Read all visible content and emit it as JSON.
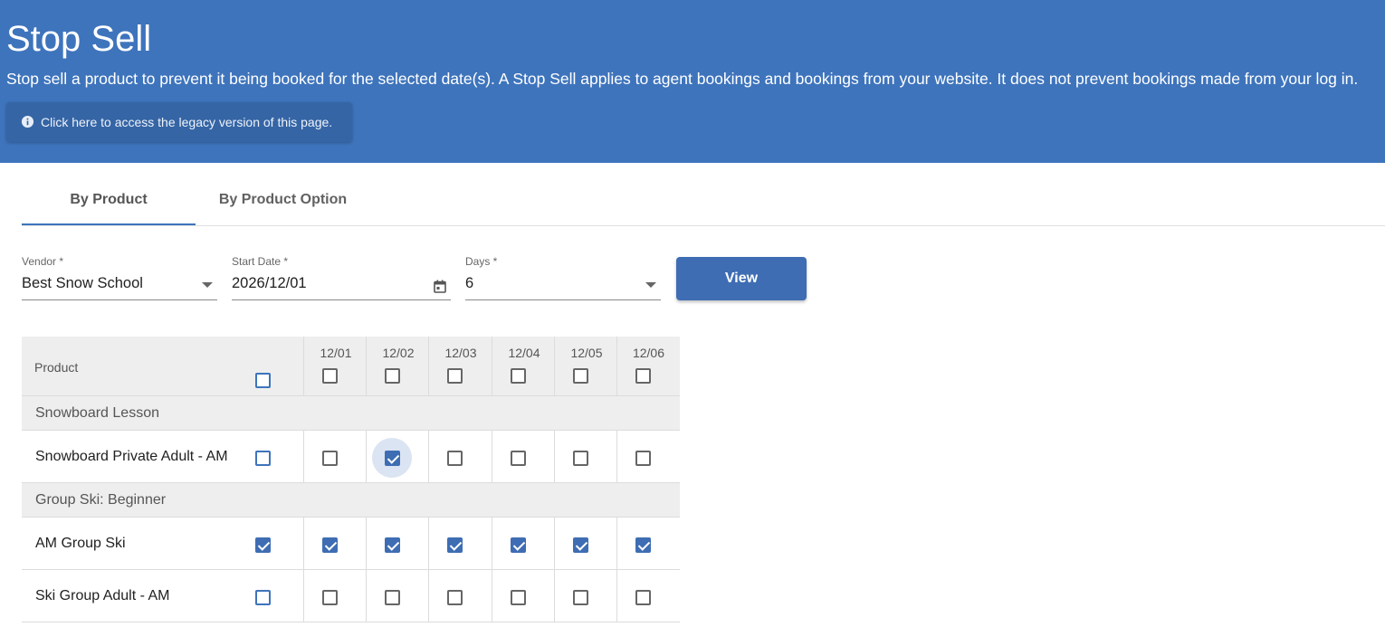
{
  "header": {
    "title": "Stop Sell",
    "description": "Stop sell a product to prevent it being booked for the selected date(s). A Stop Sell applies to agent bookings and bookings from your website. It does not prevent bookings made from your log in.",
    "legacy_link": "Click here to access the legacy version of this page.",
    "background_color": "#3e74bc"
  },
  "tabs": [
    {
      "label": "By Product",
      "active": true
    },
    {
      "label": "By Product Option",
      "active": false
    }
  ],
  "filters": {
    "vendor": {
      "label": "Vendor *",
      "value": "Best Snow School"
    },
    "start_date": {
      "label": "Start Date *",
      "value": "2026/12/01"
    },
    "days": {
      "label": "Days *",
      "value": "6"
    },
    "view_label": "View"
  },
  "table": {
    "product_header": "Product",
    "dates": [
      "12/01",
      "12/02",
      "12/03",
      "12/04",
      "12/05",
      "12/06"
    ],
    "rows": [
      {
        "type": "group",
        "label": "Snowboard Lesson"
      },
      {
        "type": "item",
        "label": "Snowboard Private Adult - AM",
        "all": false,
        "days": [
          false,
          true,
          false,
          false,
          false,
          false
        ]
      },
      {
        "type": "group",
        "label": "Group Ski: Beginner"
      },
      {
        "type": "item",
        "label": "AM Group Ski",
        "all": true,
        "days": [
          true,
          true,
          true,
          true,
          true,
          true
        ]
      },
      {
        "type": "item",
        "label": "Ski Group Adult - AM",
        "all": false,
        "days": [
          false,
          false,
          false,
          false,
          false,
          false
        ]
      }
    ]
  }
}
